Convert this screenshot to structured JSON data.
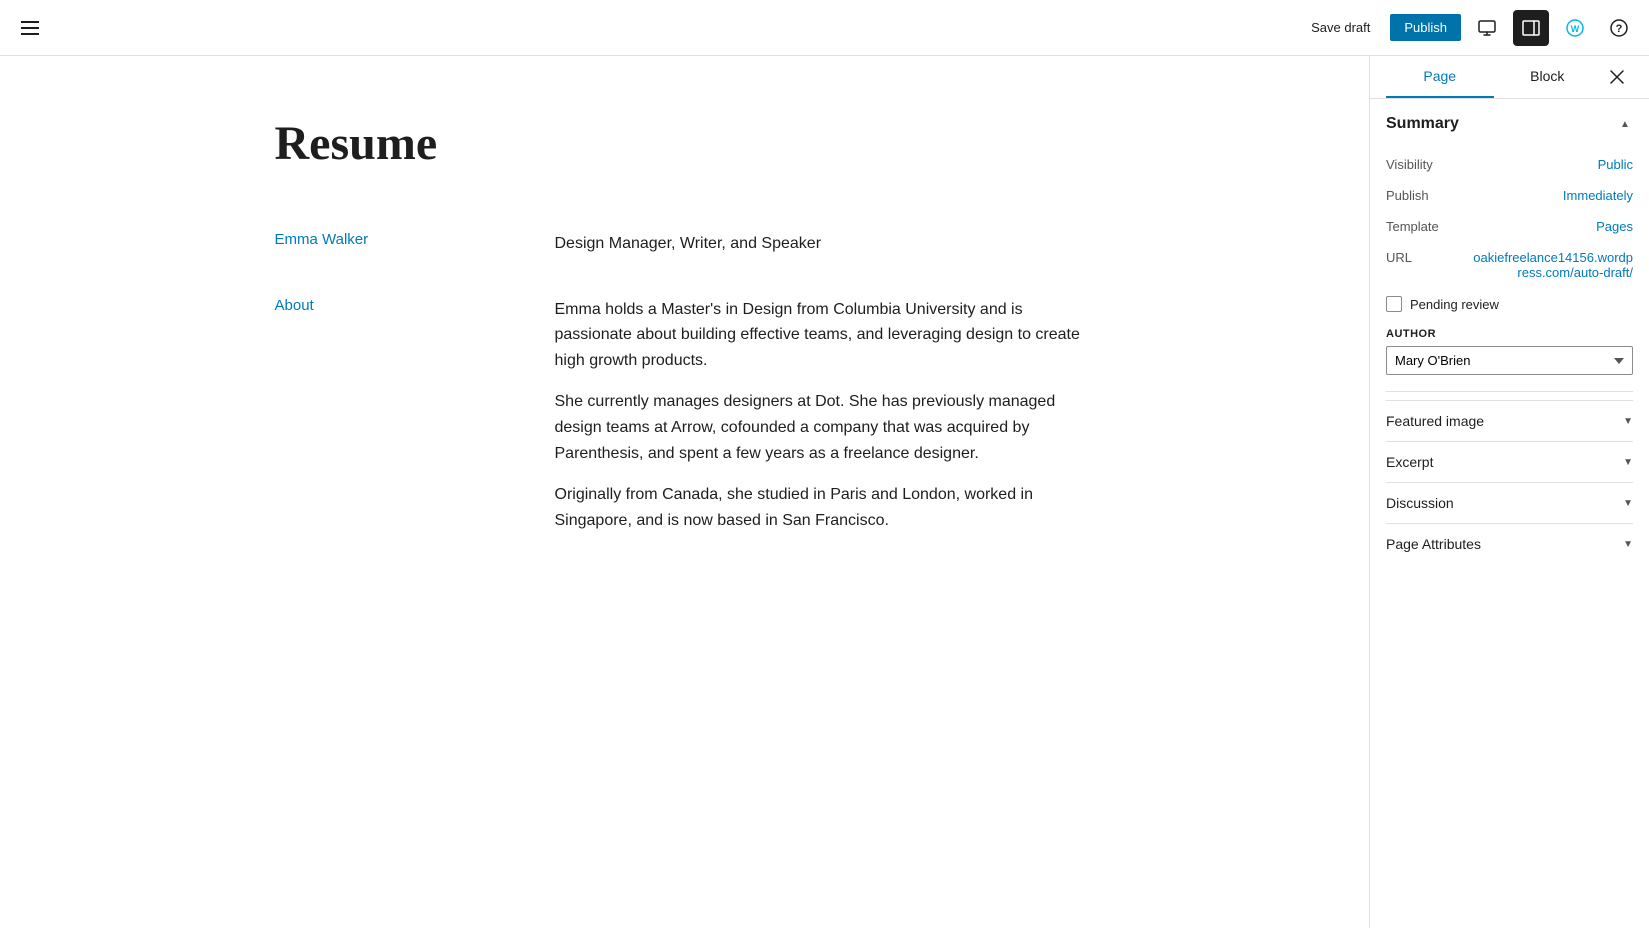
{
  "toolbar": {
    "save_draft_label": "Save draft",
    "publish_label": "Publish",
    "preview_icon": "🖥",
    "layout_icon": "⊞",
    "wordpress_icon": "W",
    "help_icon": "?"
  },
  "editor": {
    "page_title": "Resume",
    "rows": [
      {
        "label": "Emma Walker",
        "value": "Design Manager, Writer, and Speaker",
        "type": "single"
      },
      {
        "label": "About",
        "type": "paragraphs",
        "paragraphs": [
          "Emma holds a Master's in Design from Columbia University and is passionate about building effective teams, and leveraging design to create high growth products.",
          "She currently manages designers at Dot. She has previously managed design teams at Arrow, cofounded a company that was acquired by Parenthesis, and spent a few years as a freelance designer.",
          "Originally from Canada, she studied in Paris and London, worked in Singapore, and is now based in San Francisco."
        ]
      }
    ]
  },
  "sidebar": {
    "tab_page_label": "Page",
    "tab_block_label": "Block",
    "summary_title": "Summary",
    "rows": [
      {
        "label": "Visibility",
        "value": "Public"
      },
      {
        "label": "Publish",
        "value": "Immediately"
      },
      {
        "label": "Template",
        "value": "Pages"
      },
      {
        "label": "URL",
        "value": "oakiefreelance14156.wordpress.com/auto-draft/"
      }
    ],
    "pending_review_label": "Pending review",
    "author_label": "AUTHOR",
    "author_options": [
      "Mary O'Brien"
    ],
    "author_selected": "Mary O'Brien",
    "collapsible_sections": [
      {
        "label": "Featured image"
      },
      {
        "label": "Excerpt"
      },
      {
        "label": "Discussion"
      },
      {
        "label": "Page Attributes"
      }
    ]
  }
}
